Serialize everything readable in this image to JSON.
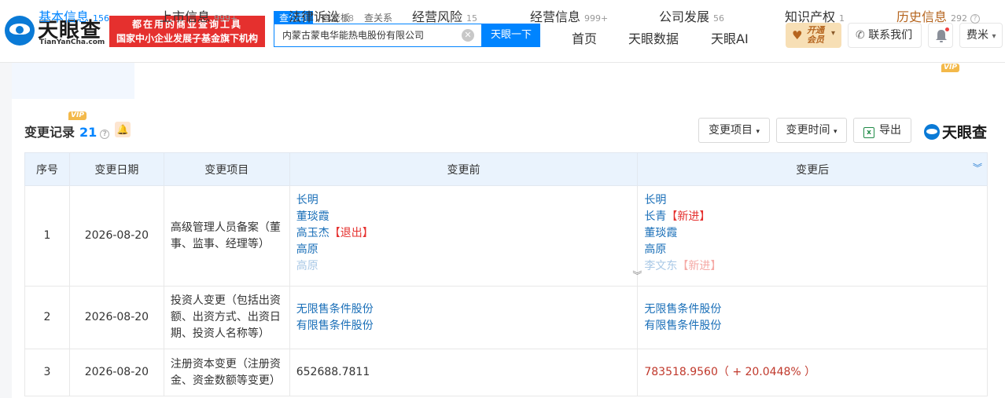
{
  "header": {
    "logo_text": "天眼查",
    "logo_sub": "TianYanCha.com",
    "banner_line1": "都在用的商业查询工具",
    "banner_line2": "国家中小企业发展子基金旗下机构",
    "search_tabs": [
      "查公司",
      "查老板",
      "查关系"
    ],
    "search_value": "内蒙古蒙电华能热电股份有限公司",
    "search_button": "天眼一下",
    "nav": [
      "首页",
      "天眼数据",
      "天眼AI"
    ],
    "vip_open_line1": "开通",
    "vip_open_line2": "会员",
    "contact": "联系我们",
    "user": "费米"
  },
  "tabs": [
    {
      "label": "基本信息",
      "count": "156"
    },
    {
      "label": "上市信息",
      "count": "999+"
    },
    {
      "label": "法律诉讼",
      "count": "78"
    },
    {
      "label": "经营风险",
      "count": "15"
    },
    {
      "label": "经营信息",
      "count": "999+"
    },
    {
      "label": "公司发展",
      "count": "56"
    },
    {
      "label": "知识产权",
      "count": "1"
    },
    {
      "label": "历史信息",
      "count": "292"
    }
  ],
  "vip_badge": "VIP",
  "section": {
    "title": "变更记录",
    "count": "21",
    "btn_item": "变更项目",
    "btn_time": "变更时间",
    "btn_export": "导出",
    "watermark": "天眼查"
  },
  "table": {
    "headers": [
      "序号",
      "变更日期",
      "变更项目",
      "变更前",
      "变更后"
    ],
    "rows": [
      {
        "no": "1",
        "date": "2026-08-20",
        "item": "高级管理人员备案（董事、监事、经理等）",
        "before": [
          "长明",
          "董琰霞",
          "高玉杰",
          "高原",
          "高原"
        ],
        "before_tag": "【退出】",
        "after": [
          "长明",
          "长青",
          "董琰霞",
          "高原",
          "李文东"
        ],
        "after_tag": "【新进】"
      },
      {
        "no": "2",
        "date": "2026-08-20",
        "item": "投资人变更（包括出资额、出资方式、出资日期、投资人名称等）",
        "before": [
          "无限售条件股份",
          "有限售条件股份"
        ],
        "after": [
          "无限售条件股份",
          "有限售条件股份"
        ]
      },
      {
        "no": "3",
        "date": "2026-08-20",
        "item": "注册资本变更（注册资金、资金数额等变更）",
        "before_value": "652688.7811",
        "after_value": "783518.9560（ + 20.0448% ）"
      }
    ]
  }
}
